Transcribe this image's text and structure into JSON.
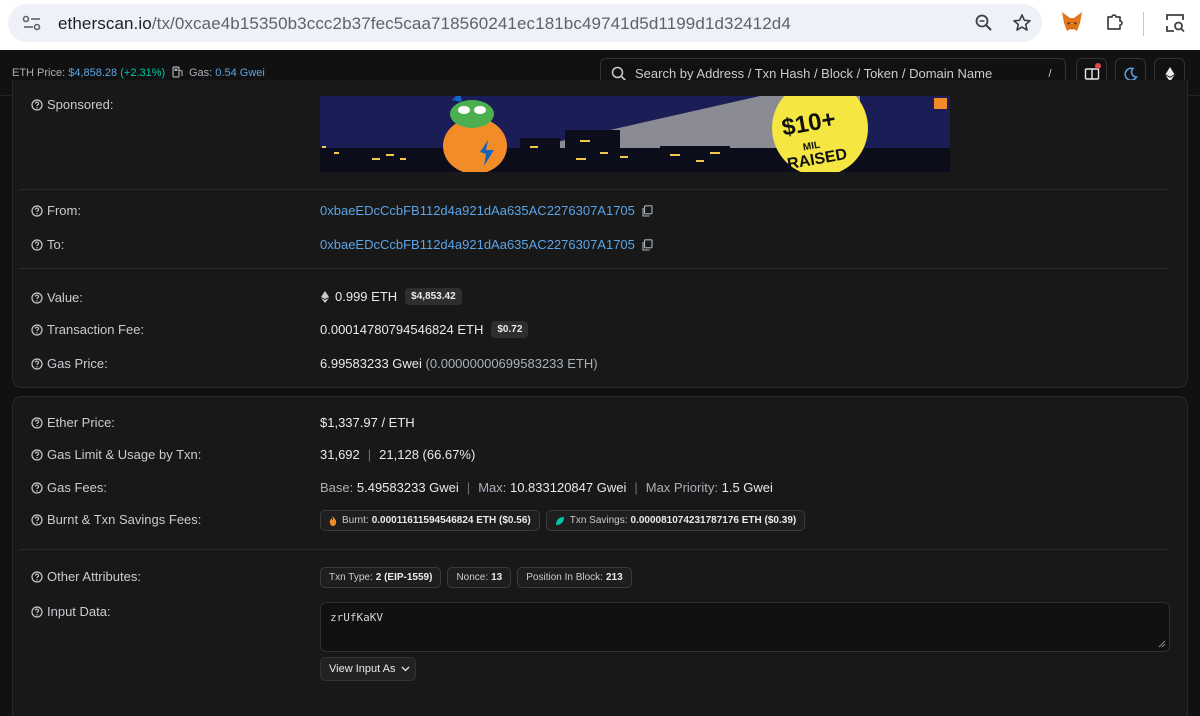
{
  "browser": {
    "url_host": "etherscan.io",
    "url_path": "/tx/0xcae4b15350b3ccc2b37fec5caa718560241ec181bc49741d5d1199d1d32412d4"
  },
  "topbar": {
    "eth_price_label": "ETH Price: ",
    "eth_price_value": "$4,858.28",
    "eth_price_change": "(+2.31%)",
    "gas_label": "Gas: ",
    "gas_value": "0.54 Gwei",
    "search_placeholder": "Search by Address / Txn Hash / Block / Token / Domain Name",
    "search_shortcut": "/"
  },
  "colors": {
    "link": "#5ba4e6",
    "positive": "#00c9a7",
    "background": "#111111",
    "card": "#181818"
  },
  "details": {
    "sponsored_label": "Sponsored:",
    "banner_text": "$10+ MIL RAISED",
    "from_label": "From:",
    "from_address": "0xbaeEDcCcbFB112d4a921dAa635AC2276307A1705",
    "to_label": "To:",
    "to_address": "0xbaeEDcCcbFB112d4a921dAa635AC2276307A1705",
    "value_label": "Value:",
    "value_amount": "0.999 ETH",
    "value_usd": "$4,853.42",
    "fee_label": "Transaction Fee:",
    "fee_amount": "0.00014780794546824 ETH",
    "fee_usd": "$0.72",
    "gas_price_label": "Gas Price:",
    "gas_price_gwei": "6.99583233 Gwei",
    "gas_price_eth": "(0.00000000699583233 ETH)"
  },
  "more": {
    "ether_price_label": "Ether Price:",
    "ether_price_value": "$1,337.97 / ETH",
    "gas_limit_label": "Gas Limit & Usage by Txn:",
    "gas_limit": "31,692",
    "gas_usage": "21,128 (66.67%)",
    "gas_fees_label": "Gas Fees:",
    "base_label": "Base: ",
    "base_value": "5.49583233 Gwei",
    "max_label": "Max: ",
    "max_value": "10.833120847 Gwei",
    "max_priority_label": "Max Priority: ",
    "max_priority_value": "1.5 Gwei",
    "burnt_label": "Burnt & Txn Savings Fees:",
    "burnt_pill_label": "Burnt:",
    "burnt_pill_value": "0.00011611594546824 ETH ($0.56)",
    "savings_pill_label": "Txn Savings:",
    "savings_pill_value": "0.000081074231787176 ETH ($0.39)",
    "other_label": "Other Attributes:",
    "txn_type_label": "Txn Type:",
    "txn_type_value": "2 (EIP-1559)",
    "nonce_label": "Nonce:",
    "nonce_value": "13",
    "position_label": "Position In Block:",
    "position_value": "213",
    "input_label": "Input Data:",
    "input_value": "zrUfKaKV",
    "view_input_label": "View Input As"
  }
}
